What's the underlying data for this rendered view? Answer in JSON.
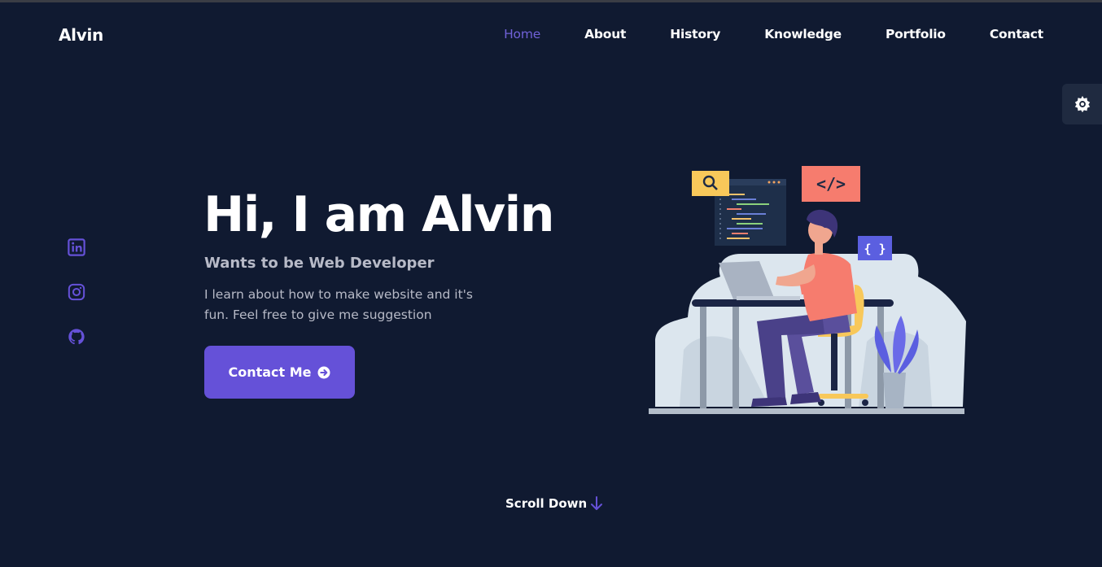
{
  "header": {
    "logo": "Alvin",
    "nav": [
      "Home",
      "About",
      "History",
      "Knowledge",
      "Portfolio",
      "Contact"
    ],
    "active": "Home"
  },
  "theme_toggle": {
    "icon": "gear-icon"
  },
  "socials": [
    {
      "icon": "linkedin-icon"
    },
    {
      "icon": "instagram-icon"
    },
    {
      "icon": "github-icon"
    }
  ],
  "hero": {
    "title": "Hi, I am Alvin",
    "subtitle": "Wants to be Web Developer",
    "description": "I learn about how to make website and it's fun. Feel free to give me suggestion",
    "button_label": "Contact Me"
  },
  "illustration": {
    "code_tag": "</>",
    "brace_tag": "{ }"
  },
  "scroll": {
    "label": "Scroll Down"
  },
  "colors": {
    "background": "#101a31",
    "accent": "#6551d8",
    "muted_text": "#b7bac7"
  }
}
